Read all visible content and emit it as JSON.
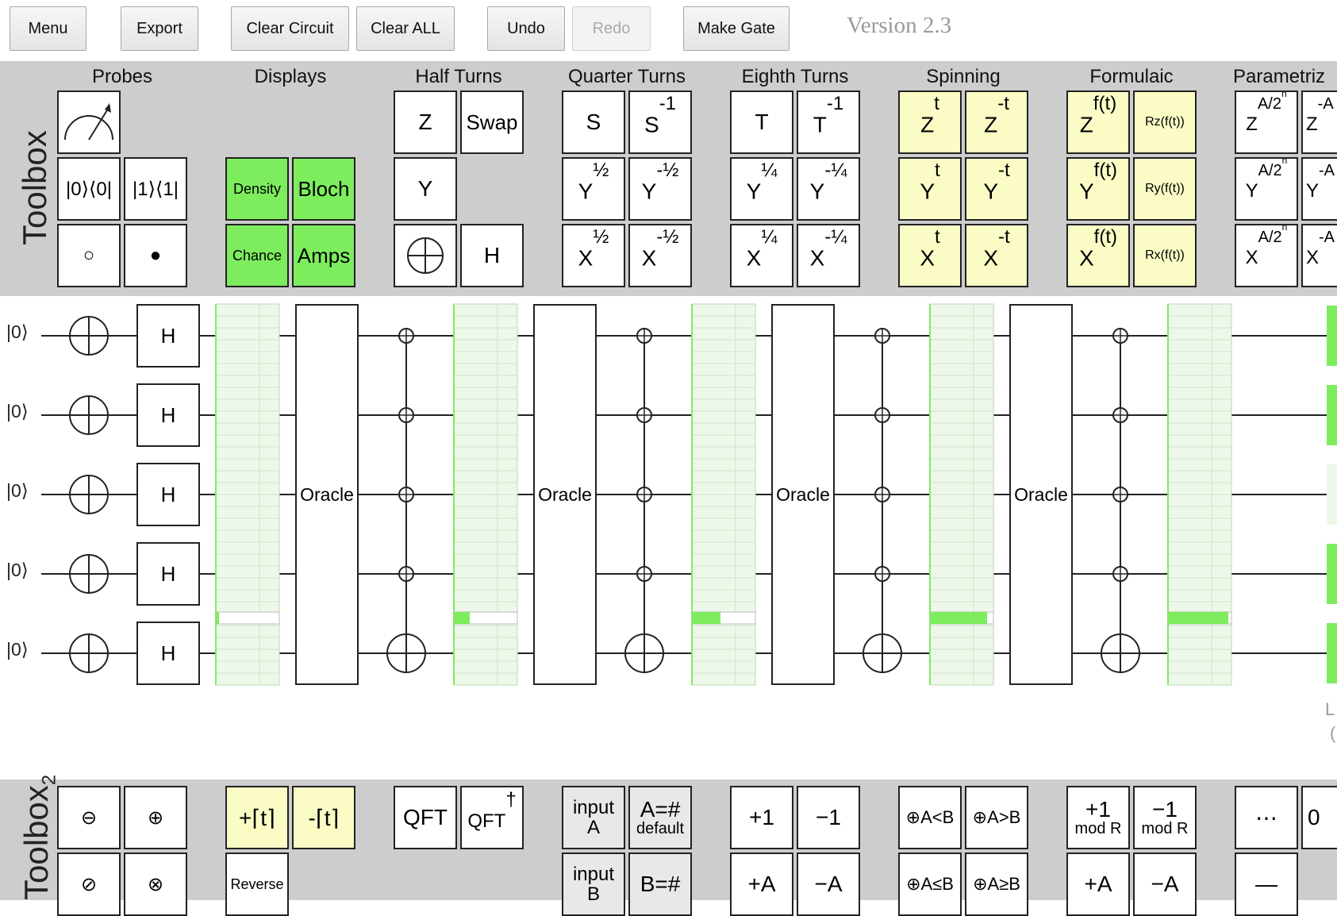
{
  "toolbar": {
    "menu": "Menu",
    "export": "Export",
    "clear_circuit": "Clear Circuit",
    "clear_all": "Clear ALL",
    "undo": "Undo",
    "redo": "Redo",
    "make_gate": "Make Gate",
    "version": "Version 2.3"
  },
  "toolbox": {
    "title": "Toolbox",
    "groups": {
      "probes": "Probes",
      "displays": "Displays",
      "half_turns": "Half Turns",
      "quarter_turns": "Quarter Turns",
      "eighth_turns": "Eighth Turns",
      "spinning": "Spinning",
      "formulaic": "Formulaic",
      "parametrized": "Parametriz"
    },
    "gates": {
      "ket0bra0": "|0⟩⟨0|",
      "ket1bra1": "|1⟩⟨1|",
      "anti_control": "○",
      "control": "●",
      "density": "Density",
      "bloch": "Bloch",
      "chance": "Chance",
      "amps": "Amps",
      "z": "Z",
      "swap": "Swap",
      "y": "Y",
      "h": "H",
      "s": "S",
      "s_base": "S",
      "s_exp": "-1",
      "y_half_base": "Y",
      "y_half_exp": "½",
      "y_mhalf_exp": "-½",
      "x_half_base": "X",
      "t": "T",
      "t_exp": "-1",
      "quarter": "¼",
      "mquarter": "-¼",
      "sp_t": "t",
      "sp_mt": "-t",
      "zbase": "Z",
      "ybase": "Y",
      "xbase": "X",
      "ft": "f(t)",
      "rz": "Rz(f(t))",
      "ry": "Ry(f(t))",
      "rx": "Rx(f(t))",
      "a2n": "A/2",
      "a2n_sup": "n",
      "ma": "-A"
    }
  },
  "toolbox2": {
    "title": "Toolbox",
    "title_sub": "2",
    "gates": {
      "minus_circle": "⊖",
      "plus_circle": "⊕",
      "slash_circle": "⊘",
      "times_circle": "⊗",
      "plus_t": "+⌈t⌉",
      "minus_t": "-⌈t⌉",
      "reverse": "Reverse",
      "qft": "QFT",
      "qft_dag": "QFT",
      "dagger": "†",
      "input": "input",
      "input_a": "A",
      "input_b": "B",
      "a_eq": "A=#",
      "b_eq": "B=#",
      "default": "default",
      "inc": "+1",
      "dec": "−1",
      "plus_a": "+A",
      "minus_a": "−A",
      "a_lt_b": "⊕A<B",
      "a_gt_b": "⊕A>B",
      "a_le_b": "⊕A≤B",
      "a_ge_b": "⊕A≥B",
      "mod_r": "mod R",
      "ellipsis": "⋯",
      "dash": "—",
      "zero": "0"
    }
  },
  "circuit": {
    "wire_label": "|0⟩",
    "h": "H",
    "oracle": "Oracle",
    "right_l": "L",
    "right_paren": "("
  },
  "chart_data": {
    "type": "bar",
    "title": "",
    "series": [
      {
        "values": [
          0.05
        ]
      },
      {
        "values": [
          0.25
        ]
      },
      {
        "values": [
          0.45
        ]
      },
      {
        "values": [
          0.9
        ]
      },
      {
        "values": [
          0.95
        ]
      }
    ]
  }
}
